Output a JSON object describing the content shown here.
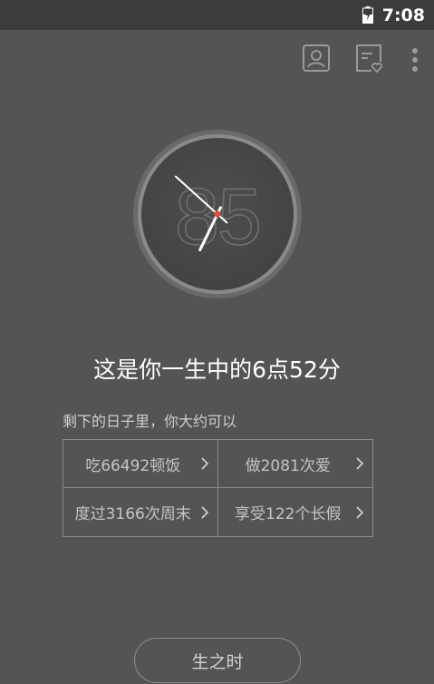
{
  "status_bar": {
    "time": "7:08",
    "battery_icon": "battery-charging-icon"
  },
  "top_actions": [
    {
      "icon": "profile-icon"
    },
    {
      "icon": "note-heart-icon"
    },
    {
      "icon": "more-vertical-icon"
    }
  ],
  "clock": {
    "number": "85",
    "hour": 6,
    "minute": 52,
    "center_dot_color": "#e24a3b"
  },
  "headline": "这是你一生中的6点52分",
  "subline": "剩下的日子里，你大约可以",
  "stats": [
    {
      "label": "吃66492顿饭"
    },
    {
      "label": "做2081次爱"
    },
    {
      "label": "度过3166次周末"
    },
    {
      "label": "享受122个长假"
    }
  ],
  "bottom_button": "生之时",
  "colors": {
    "background": "#545452",
    "status_bar": "#3c3c3c",
    "accent_red": "#e24a3b"
  }
}
